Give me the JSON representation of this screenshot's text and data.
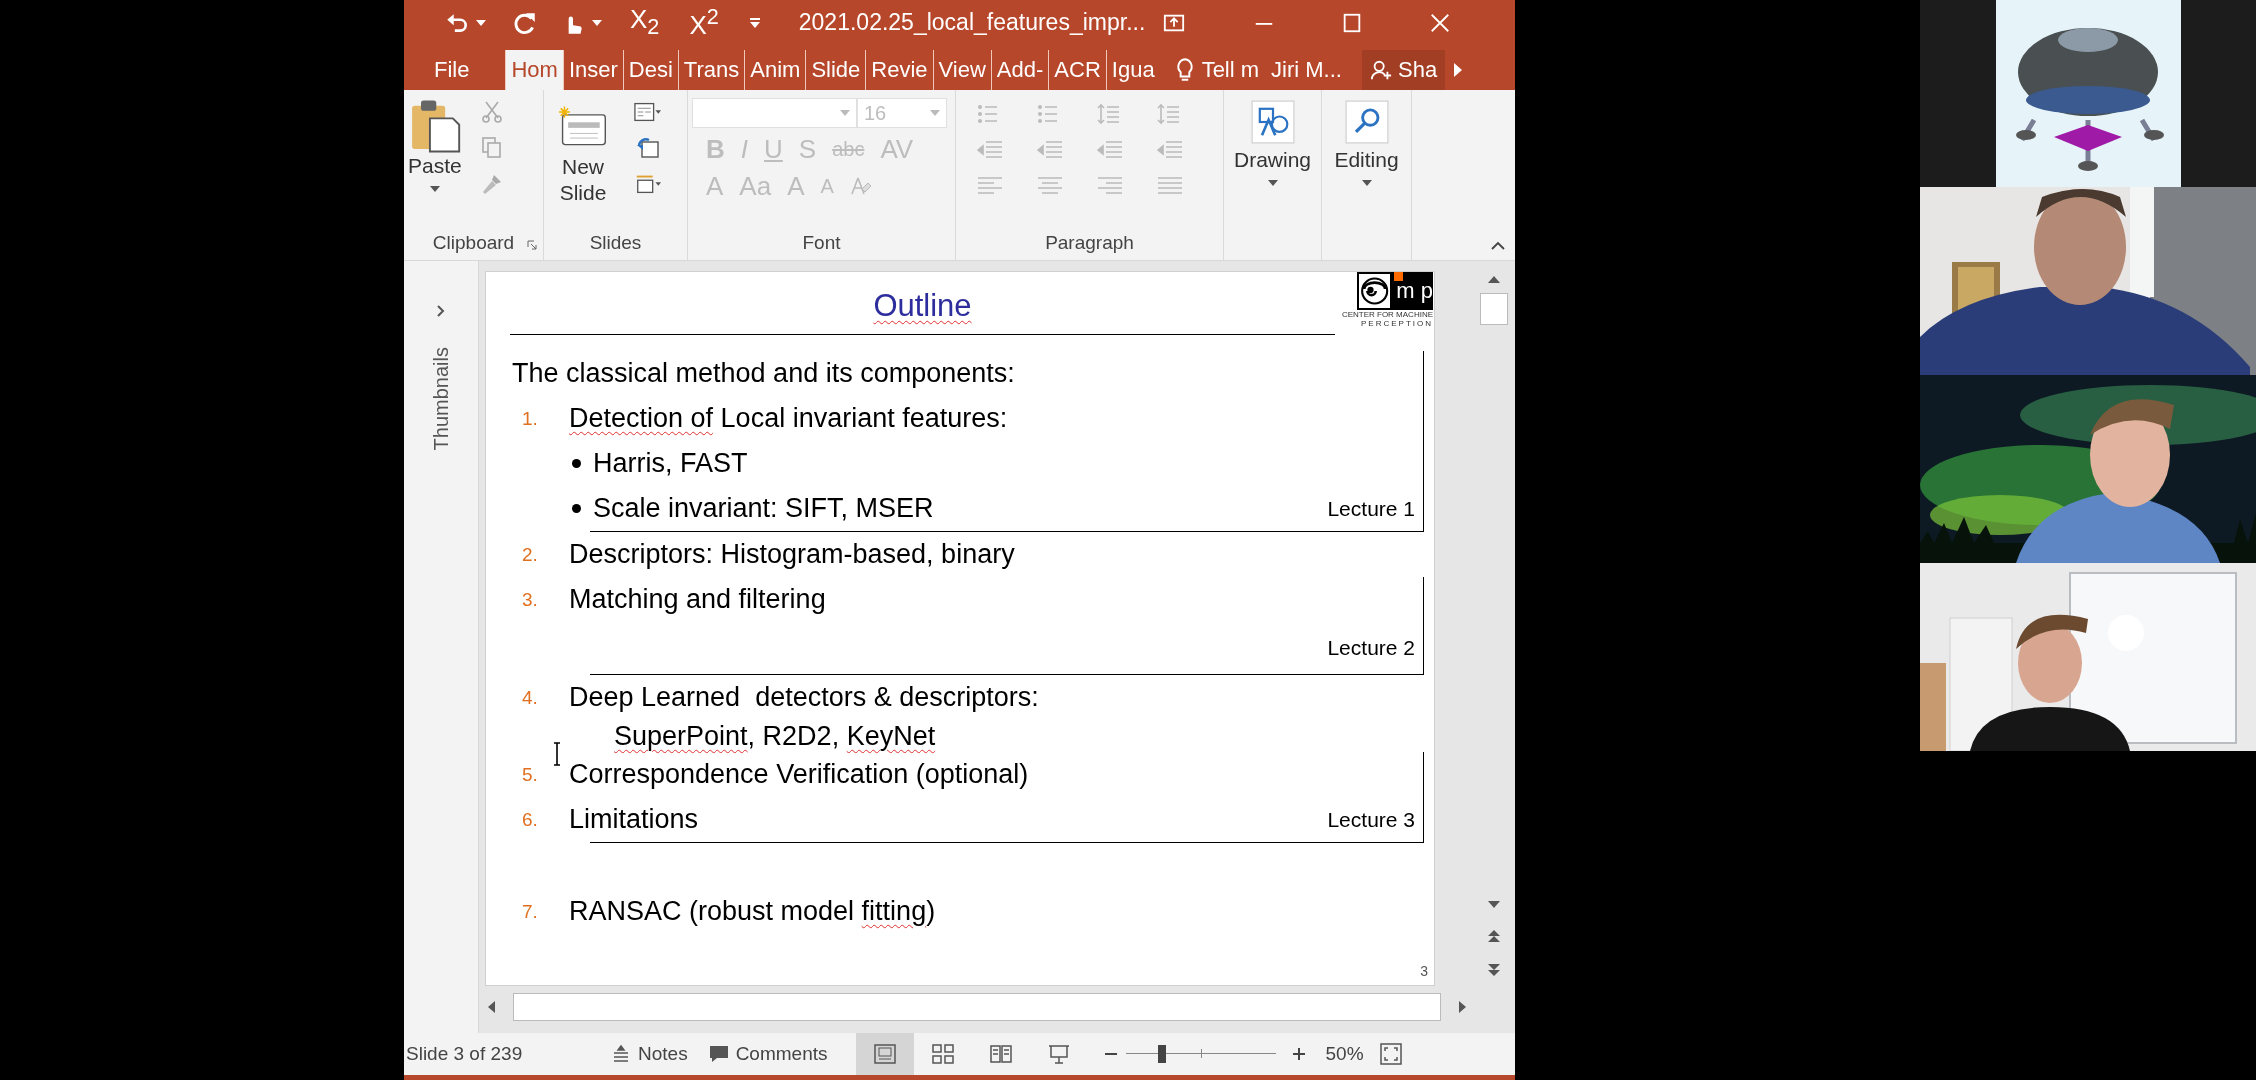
{
  "window": {
    "title": "2021.02.25_local_features_impr...",
    "quick_access": [
      "X$_{2}$",
      "X$^{2}$"
    ]
  },
  "tabs": [
    {
      "label": "File",
      "selected": false
    },
    {
      "label": "Hom",
      "selected": true
    },
    {
      "label": "Inser",
      "selected": false
    },
    {
      "label": "Desi",
      "selected": false
    },
    {
      "label": "Trans",
      "selected": false
    },
    {
      "label": "Anim",
      "selected": false
    },
    {
      "label": "Slide",
      "selected": false
    },
    {
      "label": "Revie",
      "selected": false
    },
    {
      "label": "View",
      "selected": false
    },
    {
      "label": "Add-",
      "selected": false
    },
    {
      "label": "ACR",
      "selected": false
    },
    {
      "label": "Igua",
      "selected": false
    }
  ],
  "tell_me": "Tell m",
  "user": "Jiri M...",
  "share": "Sha",
  "ribbon": {
    "clipboard": {
      "label": "Clipboard",
      "paste": "Paste"
    },
    "slides": {
      "label": "Slides",
      "new_slide": "New Slide"
    },
    "font": {
      "label": "Font",
      "disabled": true,
      "size": "16",
      "format_buttons": [
        "B",
        "I",
        "U",
        "S",
        "abc",
        "AV"
      ],
      "size_buttons": [
        "A",
        "Aa",
        "A",
        "A"
      ]
    },
    "paragraph": {
      "label": "Paragraph",
      "disabled": true
    },
    "drawing": "Drawing",
    "editing": "Editing"
  },
  "sidebar": {
    "label": "Thumbnails"
  },
  "slide": {
    "title": "Outline",
    "logo": {
      "letters": "m p",
      "caption_1": "CENTER FOR MACHINE",
      "caption_2": "PERCEPTION"
    },
    "intro": "The classical method and its components:",
    "sections": [
      {
        "kind": "box",
        "lecture": "Lecture 1",
        "items": [
          {
            "number": "1.",
            "parts": [
              {
                "text": "Detection of",
                "flagged": true
              },
              {
                "text": " Local invariant features:",
                "flagged": false
              }
            ],
            "bullets": [
              "Harris, FAST",
              "Scale invariant: SIFT, MSER"
            ]
          }
        ]
      },
      {
        "kind": "plain",
        "items": [
          {
            "number": "2.",
            "parts": [
              {
                "text": "Descriptors: Histogram-based, binary",
                "flagged": false
              }
            ]
          }
        ]
      },
      {
        "kind": "box_label_below",
        "lecture": "Lecture 2",
        "items": [
          {
            "number": "3.",
            "parts": [
              {
                "text": "Matching and filtering",
                "flagged": false
              }
            ]
          }
        ]
      },
      {
        "kind": "plain",
        "items": [
          {
            "number": "4.",
            "parts": [
              {
                "text": "Deep Learned  detectors & descriptors:",
                "flagged": false
              }
            ],
            "continuation": [
              {
                "text": "SuperPoint",
                "flagged": true
              },
              {
                "text": ", R2D2, ",
                "flagged": false
              },
              {
                "text": "KeyNet",
                "flagged": true
              }
            ]
          }
        ]
      },
      {
        "kind": "box",
        "lecture": "Lecture 3",
        "items": [
          {
            "number": "5.",
            "parts": [
              {
                "text": "Correspondence Verification (optional)",
                "flagged": false
              }
            ]
          },
          {
            "number": "6.",
            "parts": [
              {
                "text": "Limitations",
                "flagged": false
              }
            ]
          }
        ]
      },
      {
        "kind": "plain_spaced",
        "items": [
          {
            "number": "7.",
            "parts": [
              {
                "text": "RANSAC (robust model ",
                "flagged": false
              },
              {
                "text": "fitting",
                "flagged": true
              },
              {
                "text": ")",
                "flagged": false
              }
            ]
          }
        ]
      }
    ],
    "page_number": "3"
  },
  "status_bar": {
    "slide_info": "Slide 3 of 239",
    "notes": "Notes",
    "comments": "Comments",
    "views": [
      {
        "kind": "normal",
        "selected": true
      },
      {
        "kind": "sorter",
        "selected": false
      },
      {
        "kind": "reading",
        "selected": false
      },
      {
        "kind": "slideshow",
        "selected": false
      }
    ],
    "zoom": {
      "level": 0.24,
      "reading": "50%"
    }
  }
}
